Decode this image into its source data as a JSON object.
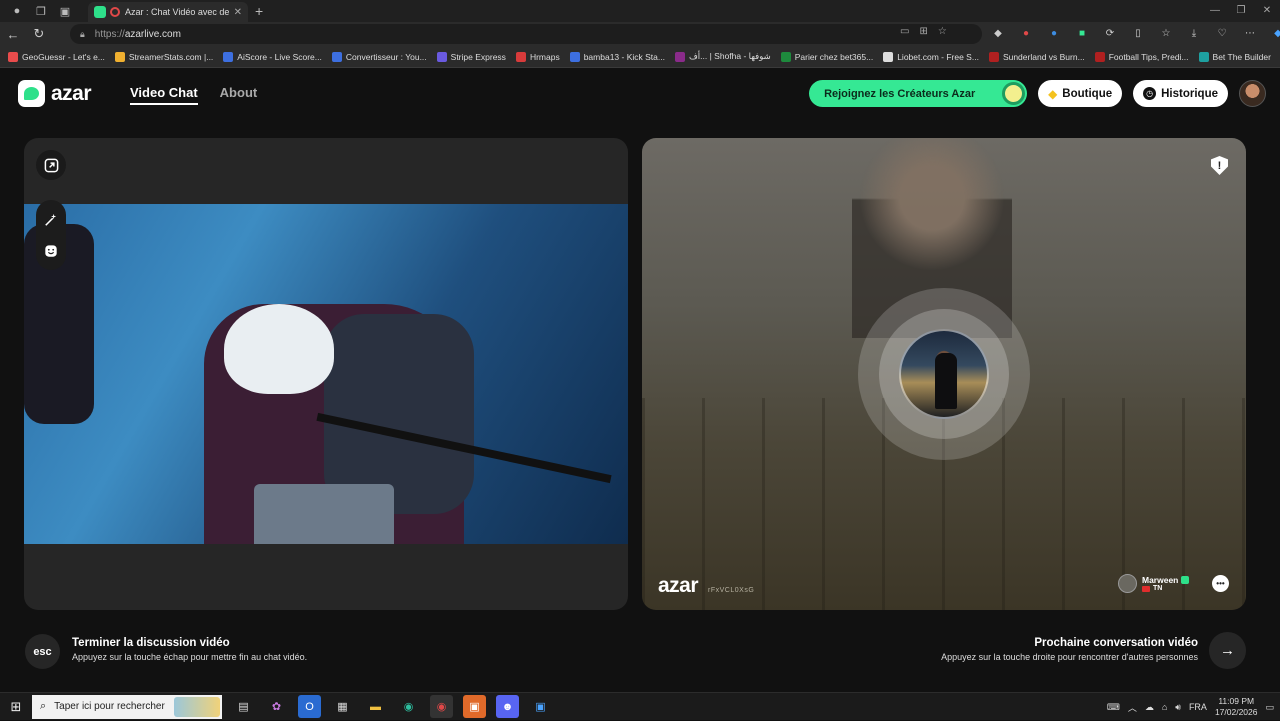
{
  "browser": {
    "tab_title": "Azar : Chat Vidéo avec de n",
    "url_proto": "https://",
    "url_host": "azarlive.com"
  },
  "bookmarks": [
    {
      "label": "GeoGuessr - Let's e...",
      "color": "#e94c4c"
    },
    {
      "label": "StreamerStats.com |...",
      "color": "#f0b030"
    },
    {
      "label": "AiScore - Live Score...",
      "color": "#3d6fe0"
    },
    {
      "label": "Convertisseur : You...",
      "color": "#3d6fe0"
    },
    {
      "label": "Stripe Express",
      "color": "#6a5ae0"
    },
    {
      "label": "Hrmaps",
      "color": "#d83b3b"
    },
    {
      "label": "bamba13 - Kick Sta...",
      "color": "#3d6fe0"
    },
    {
      "label": "أف... | Shofha - شوفها",
      "color": "#8a2b8a"
    },
    {
      "label": "Parier chez bet365...",
      "color": "#1e8a3d"
    },
    {
      "label": "Liobet.com - Free S...",
      "color": "#dddddd"
    },
    {
      "label": "Sunderland vs Burn...",
      "color": "#b02020"
    },
    {
      "label": "Football Tips, Predi...",
      "color": "#b02020"
    },
    {
      "label": "Bet The Builder",
      "color": "#1ea0a0"
    }
  ],
  "header": {
    "logo_text": "azar",
    "nav": {
      "video_chat": "Video Chat",
      "about": "About"
    },
    "creators_button": "Rejoignez les Créateurs Azar",
    "shop_button": "Boutique",
    "history_button": "Historique"
  },
  "remote": {
    "watermark": "azar",
    "watermark_code": "rFxVCL0XsG",
    "peer_name": "Marween",
    "peer_country": "TN",
    "report_symbol": "!"
  },
  "controls": {
    "esc_key": "esc",
    "end_title": "Terminer la discussion vidéo",
    "end_hint": "Appuyez sur la touche échap pour mettre fin au chat vidéo.",
    "next_title": "Prochaine conversation vidéo",
    "next_hint": "Appuyez sur la touche droite pour rencontrer d'autres personnes",
    "next_arrow": "→"
  },
  "taskbar": {
    "search_placeholder": "Taper ici pour rechercher",
    "language": "FRA",
    "time": "11:09 PM",
    "date": "17/02/2026"
  },
  "colors": {
    "accent_green": "#35e894",
    "panel_bg": "#262626",
    "page_bg": "#111111"
  }
}
